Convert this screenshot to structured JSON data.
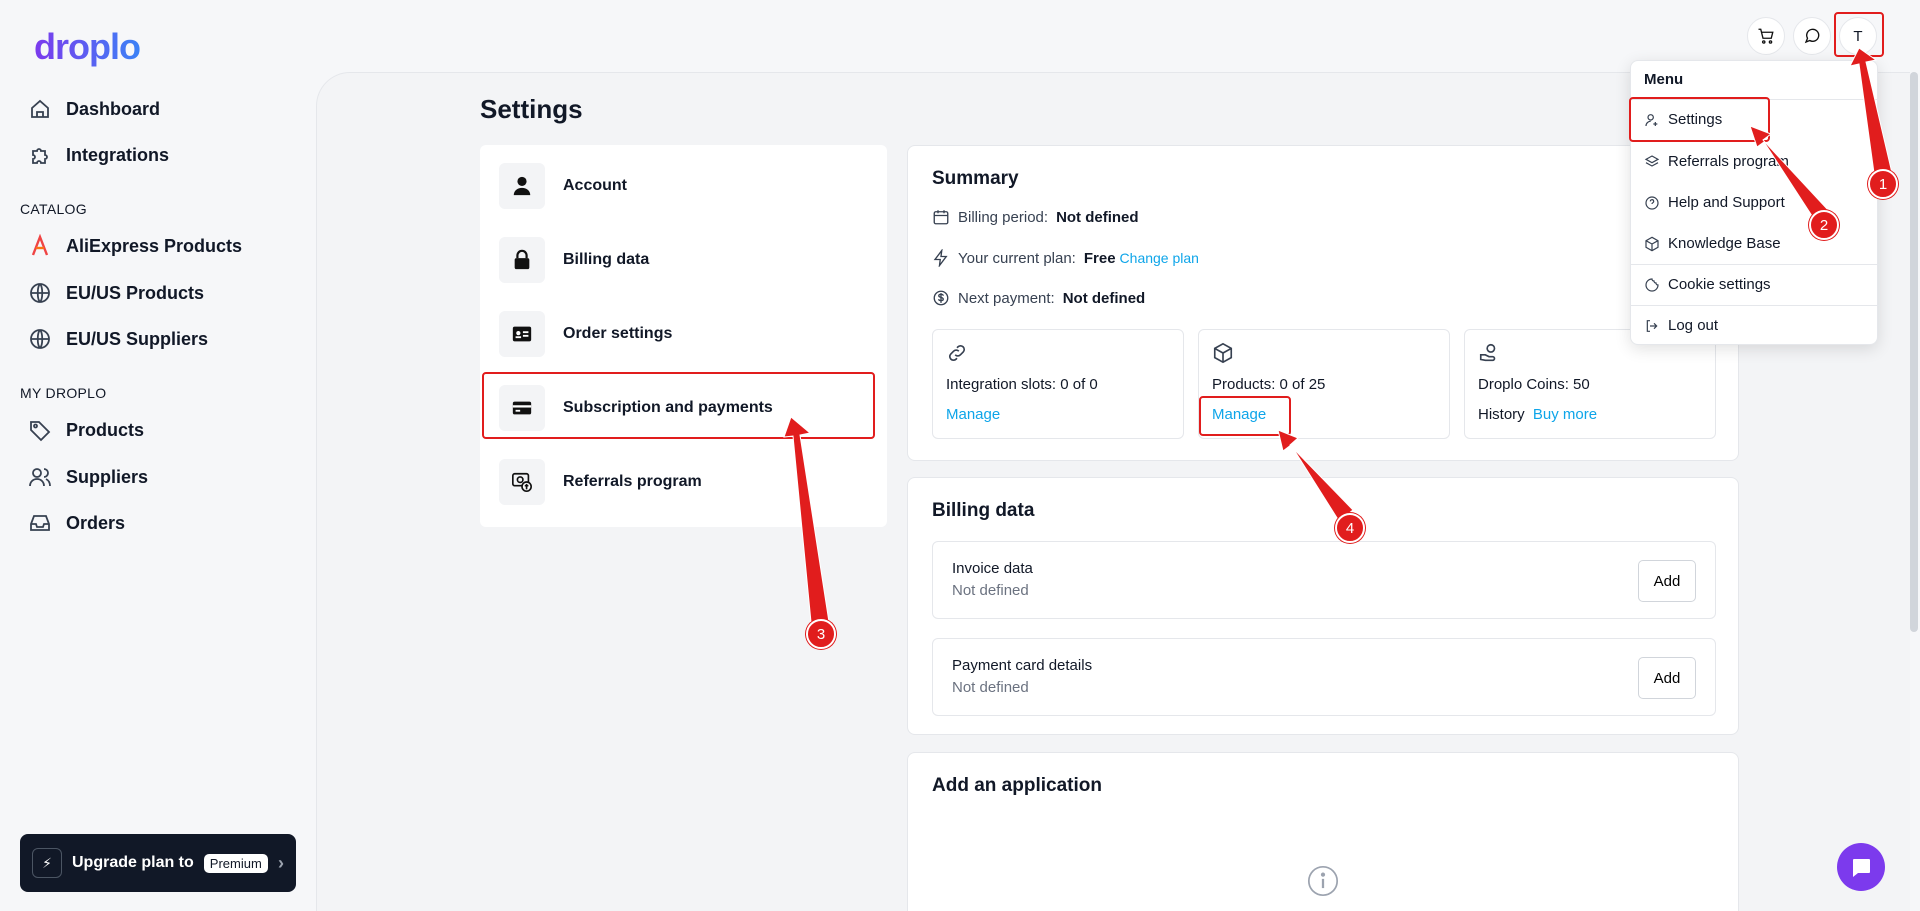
{
  "brand": {
    "logo": "droplo"
  },
  "sidebar": {
    "main_items": [
      {
        "label": "Dashboard",
        "icon": "home-icon"
      },
      {
        "label": "Integrations",
        "icon": "puzzle-icon"
      }
    ],
    "catalog_label": "CATALOG",
    "catalog_items": [
      {
        "label": "AliExpress Products",
        "icon": "aliexpress-icon"
      },
      {
        "label": "EU/US Products",
        "icon": "globe-icon"
      },
      {
        "label": "EU/US Suppliers",
        "icon": "globe-icon"
      }
    ],
    "my_label": "MY DROPLO",
    "my_items": [
      {
        "label": "Products",
        "icon": "tag-icon"
      },
      {
        "label": "Suppliers",
        "icon": "users-icon"
      },
      {
        "label": "Orders",
        "icon": "inbox-icon"
      }
    ],
    "upgrade": {
      "label": "Upgrade plan to",
      "badge": "Premium"
    }
  },
  "page": {
    "title": "Settings"
  },
  "settings_menu": [
    {
      "label": "Account",
      "icon": "user-icon"
    },
    {
      "label": "Billing data",
      "icon": "lock-icon"
    },
    {
      "label": "Order settings",
      "icon": "id-card-icon"
    },
    {
      "label": "Subscription and payments",
      "icon": "credit-card-icon"
    },
    {
      "label": "Referrals program",
      "icon": "referral-icon"
    }
  ],
  "summary": {
    "title": "Summary",
    "billing_period_label": "Billing period:",
    "billing_period_value": "Not defined",
    "plan_label": "Your current plan:",
    "plan_value": "Free",
    "plan_link": "Change plan",
    "next_payment_label": "Next payment:",
    "next_payment_value": "Not defined",
    "tiles": [
      {
        "label": "Integration slots: 0 of 0",
        "action": "Manage",
        "icon": "link-icon"
      },
      {
        "label": "Products: 0 of 25",
        "action": "Manage",
        "icon": "box-icon"
      },
      {
        "label": "Droplo Coins: 50",
        "history": "History",
        "action": "Buy more",
        "icon": "coins-icon"
      }
    ]
  },
  "billing": {
    "title": "Billing data",
    "rows": [
      {
        "title": "Invoice data",
        "value": "Not defined",
        "button": "Add"
      },
      {
        "title": "Payment card details",
        "value": "Not defined",
        "button": "Add"
      }
    ]
  },
  "application": {
    "title": "Add an application"
  },
  "user_menu": {
    "avatar": "T",
    "title": "Menu",
    "items": [
      {
        "label": "Settings",
        "icon": "user-settings-icon"
      },
      {
        "label": "Referrals program",
        "icon": "layers-icon"
      },
      {
        "label": "Help and Support",
        "icon": "help-icon"
      },
      {
        "label": "Knowledge Base",
        "icon": "cube-icon"
      },
      {
        "label": "Cookie settings",
        "icon": "cookie-icon"
      },
      {
        "label": "Log out",
        "icon": "logout-icon"
      }
    ]
  },
  "annotations": [
    "1",
    "2",
    "3",
    "4"
  ],
  "colors": {
    "accent": "#0ea5e9",
    "annotation": "#e11d1d",
    "brand": "#7c3aed"
  }
}
